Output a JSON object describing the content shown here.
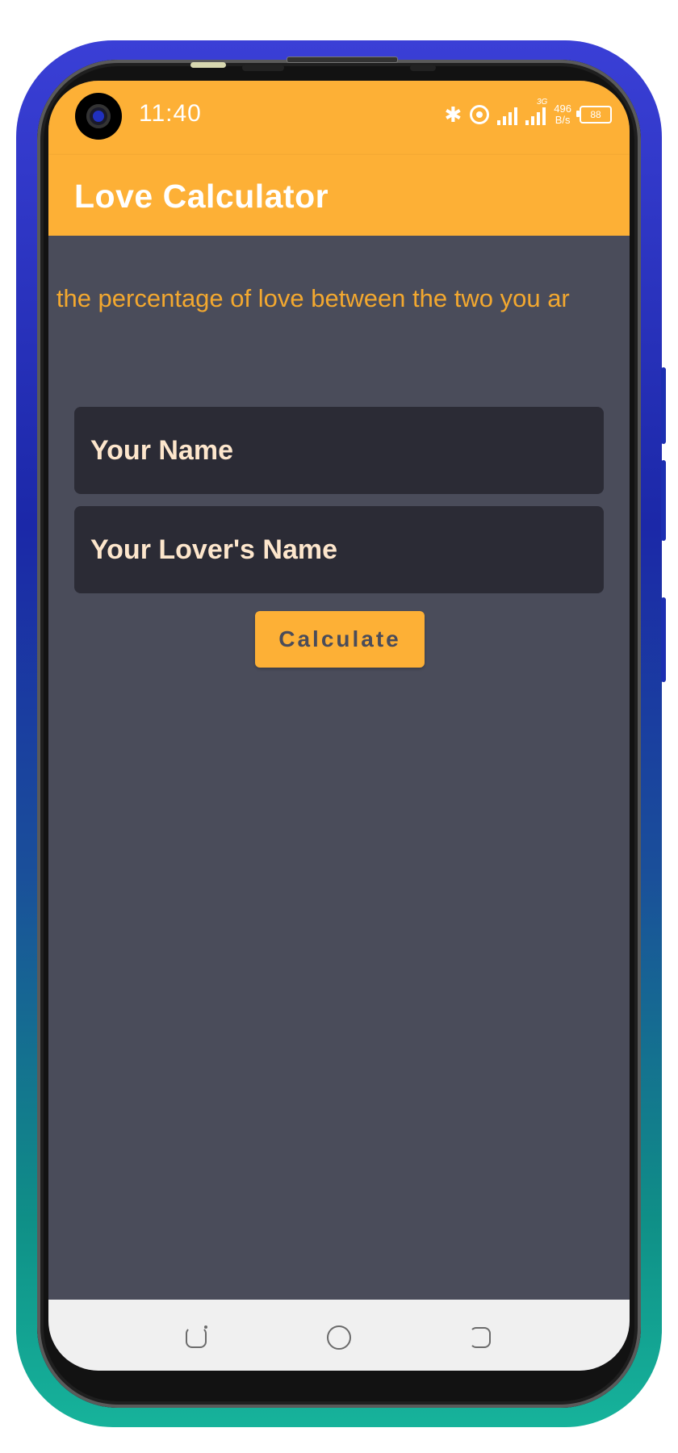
{
  "status_bar": {
    "time": "11:40",
    "network_type": "3G",
    "speed_value": "496",
    "speed_unit": "B/s",
    "battery": "88"
  },
  "app_bar": {
    "title": "Love Calculator"
  },
  "main": {
    "marquee_text": "ulate the percentage of love between the two you ar",
    "your_name_placeholder": "Your Name",
    "lover_name_placeholder": "Your Lover's Name",
    "calculate_label": "Calculate"
  },
  "colors": {
    "accent": "#fdb036",
    "background": "#4a4c5a",
    "input_background": "#2b2b35",
    "input_text": "#fde6cc",
    "marquee_text": "#f3a82f"
  },
  "icons": {
    "bluetooth": "bluetooth-icon",
    "hotspot": "hotspot-icon",
    "signal": "signal-icon",
    "battery": "battery-icon",
    "nav_back": "back-icon",
    "nav_home": "home-icon",
    "nav_recent": "recents-icon"
  }
}
